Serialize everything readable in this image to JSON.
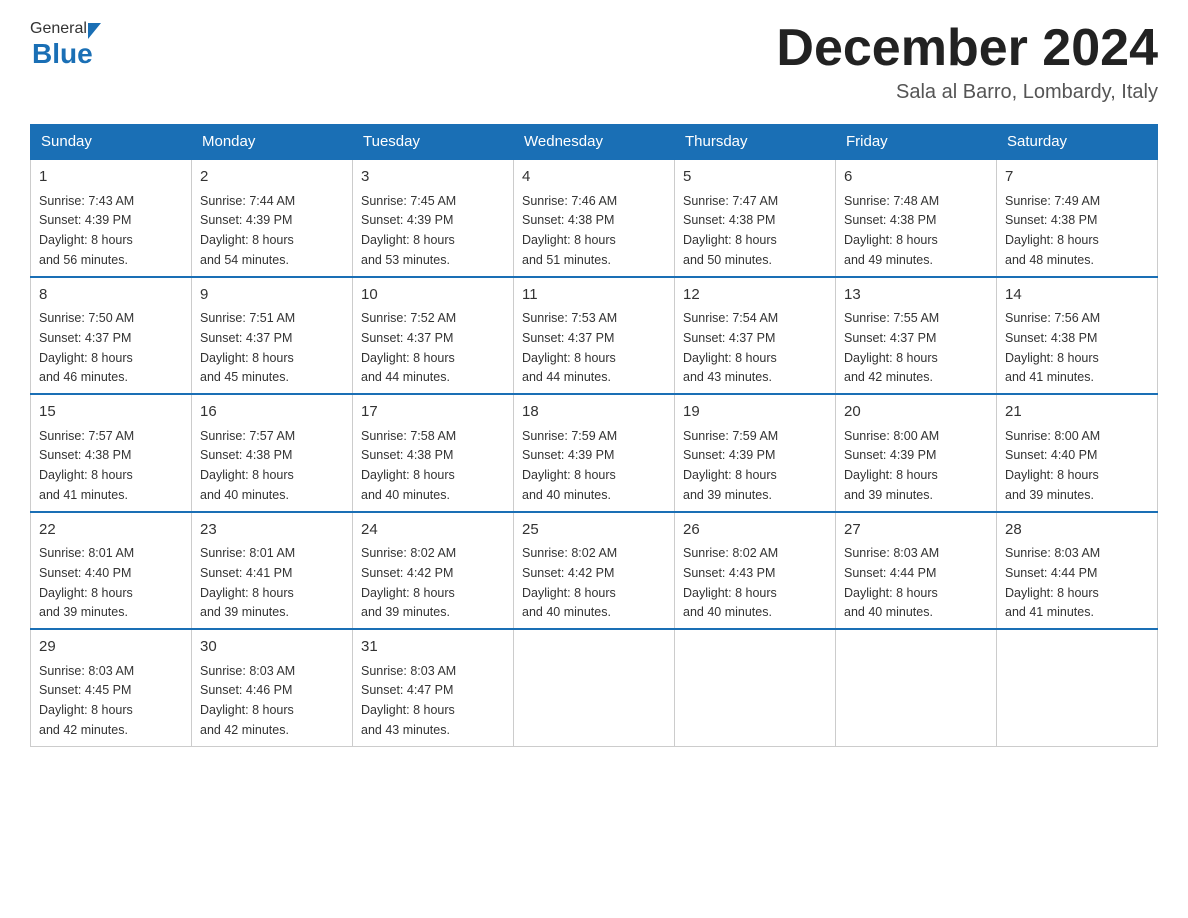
{
  "header": {
    "logo_general": "General",
    "logo_blue": "Blue",
    "month_title": "December 2024",
    "subtitle": "Sala al Barro, Lombardy, Italy"
  },
  "columns": [
    "Sunday",
    "Monday",
    "Tuesday",
    "Wednesday",
    "Thursday",
    "Friday",
    "Saturday"
  ],
  "weeks": [
    [
      {
        "day": "1",
        "sunrise": "7:43 AM",
        "sunset": "4:39 PM",
        "daylight": "8 hours and 56 minutes."
      },
      {
        "day": "2",
        "sunrise": "7:44 AM",
        "sunset": "4:39 PM",
        "daylight": "8 hours and 54 minutes."
      },
      {
        "day": "3",
        "sunrise": "7:45 AM",
        "sunset": "4:39 PM",
        "daylight": "8 hours and 53 minutes."
      },
      {
        "day": "4",
        "sunrise": "7:46 AM",
        "sunset": "4:38 PM",
        "daylight": "8 hours and 51 minutes."
      },
      {
        "day": "5",
        "sunrise": "7:47 AM",
        "sunset": "4:38 PM",
        "daylight": "8 hours and 50 minutes."
      },
      {
        "day": "6",
        "sunrise": "7:48 AM",
        "sunset": "4:38 PM",
        "daylight": "8 hours and 49 minutes."
      },
      {
        "day": "7",
        "sunrise": "7:49 AM",
        "sunset": "4:38 PM",
        "daylight": "8 hours and 48 minutes."
      }
    ],
    [
      {
        "day": "8",
        "sunrise": "7:50 AM",
        "sunset": "4:37 PM",
        "daylight": "8 hours and 46 minutes."
      },
      {
        "day": "9",
        "sunrise": "7:51 AM",
        "sunset": "4:37 PM",
        "daylight": "8 hours and 45 minutes."
      },
      {
        "day": "10",
        "sunrise": "7:52 AM",
        "sunset": "4:37 PM",
        "daylight": "8 hours and 44 minutes."
      },
      {
        "day": "11",
        "sunrise": "7:53 AM",
        "sunset": "4:37 PM",
        "daylight": "8 hours and 44 minutes."
      },
      {
        "day": "12",
        "sunrise": "7:54 AM",
        "sunset": "4:37 PM",
        "daylight": "8 hours and 43 minutes."
      },
      {
        "day": "13",
        "sunrise": "7:55 AM",
        "sunset": "4:37 PM",
        "daylight": "8 hours and 42 minutes."
      },
      {
        "day": "14",
        "sunrise": "7:56 AM",
        "sunset": "4:38 PM",
        "daylight": "8 hours and 41 minutes."
      }
    ],
    [
      {
        "day": "15",
        "sunrise": "7:57 AM",
        "sunset": "4:38 PM",
        "daylight": "8 hours and 41 minutes."
      },
      {
        "day": "16",
        "sunrise": "7:57 AM",
        "sunset": "4:38 PM",
        "daylight": "8 hours and 40 minutes."
      },
      {
        "day": "17",
        "sunrise": "7:58 AM",
        "sunset": "4:38 PM",
        "daylight": "8 hours and 40 minutes."
      },
      {
        "day": "18",
        "sunrise": "7:59 AM",
        "sunset": "4:39 PM",
        "daylight": "8 hours and 40 minutes."
      },
      {
        "day": "19",
        "sunrise": "7:59 AM",
        "sunset": "4:39 PM",
        "daylight": "8 hours and 39 minutes."
      },
      {
        "day": "20",
        "sunrise": "8:00 AM",
        "sunset": "4:39 PM",
        "daylight": "8 hours and 39 minutes."
      },
      {
        "day": "21",
        "sunrise": "8:00 AM",
        "sunset": "4:40 PM",
        "daylight": "8 hours and 39 minutes."
      }
    ],
    [
      {
        "day": "22",
        "sunrise": "8:01 AM",
        "sunset": "4:40 PM",
        "daylight": "8 hours and 39 minutes."
      },
      {
        "day": "23",
        "sunrise": "8:01 AM",
        "sunset": "4:41 PM",
        "daylight": "8 hours and 39 minutes."
      },
      {
        "day": "24",
        "sunrise": "8:02 AM",
        "sunset": "4:42 PM",
        "daylight": "8 hours and 39 minutes."
      },
      {
        "day": "25",
        "sunrise": "8:02 AM",
        "sunset": "4:42 PM",
        "daylight": "8 hours and 40 minutes."
      },
      {
        "day": "26",
        "sunrise": "8:02 AM",
        "sunset": "4:43 PM",
        "daylight": "8 hours and 40 minutes."
      },
      {
        "day": "27",
        "sunrise": "8:03 AM",
        "sunset": "4:44 PM",
        "daylight": "8 hours and 40 minutes."
      },
      {
        "day": "28",
        "sunrise": "8:03 AM",
        "sunset": "4:44 PM",
        "daylight": "8 hours and 41 minutes."
      }
    ],
    [
      {
        "day": "29",
        "sunrise": "8:03 AM",
        "sunset": "4:45 PM",
        "daylight": "8 hours and 42 minutes."
      },
      {
        "day": "30",
        "sunrise": "8:03 AM",
        "sunset": "4:46 PM",
        "daylight": "8 hours and 42 minutes."
      },
      {
        "day": "31",
        "sunrise": "8:03 AM",
        "sunset": "4:47 PM",
        "daylight": "8 hours and 43 minutes."
      },
      null,
      null,
      null,
      null
    ]
  ],
  "labels": {
    "sunrise": "Sunrise: ",
    "sunset": "Sunset: ",
    "daylight": "Daylight: "
  }
}
